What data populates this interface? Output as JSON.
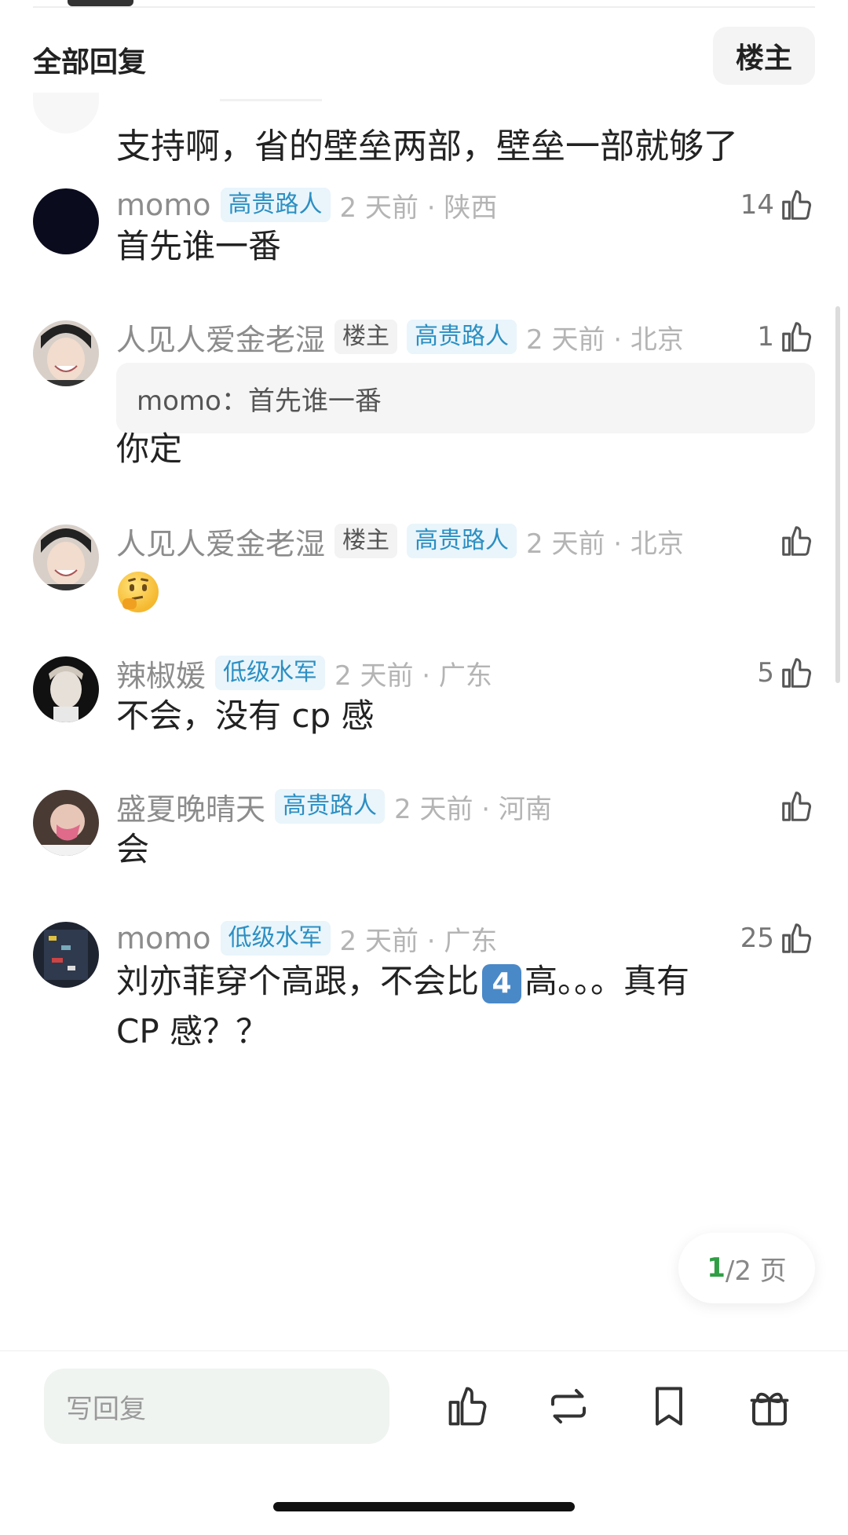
{
  "header": {
    "title": "全部回复",
    "owner_filter": "楼主"
  },
  "partial_comment": {
    "text": "支持啊，省的壁垒两部，壁垒一部就够了"
  },
  "comments": [
    {
      "username": "momo",
      "badges": [
        "高贵路人"
      ],
      "time": "2 天前 · 陕西",
      "likes": "14",
      "text": "首先谁一番"
    },
    {
      "username": "人见人爱金老湿",
      "badges": [
        "楼主",
        "高贵路人"
      ],
      "time": "2 天前 · 北京",
      "likes": "1",
      "quote": "momo：首先谁一番",
      "text": "你定"
    },
    {
      "username": "人见人爱金老湿",
      "badges": [
        "楼主",
        "高贵路人"
      ],
      "time": "2 天前 · 北京",
      "likes": "",
      "emoji": "thinking-face"
    },
    {
      "username": "辣椒媛",
      "badges": [
        "低级水军"
      ],
      "time": "2 天前 · 广东",
      "likes": "5",
      "text": "不会，没有 cp 感"
    },
    {
      "username": "盛夏晚晴天",
      "badges": [
        "高贵路人"
      ],
      "time": "2 天前 · 河南",
      "likes": "",
      "text": "会"
    },
    {
      "username": "momo",
      "badges": [
        "低级水军"
      ],
      "time": "2 天前 · 广东",
      "likes": "25",
      "text_a": "刘亦菲穿个高跟，不会比",
      "keycap": "4",
      "text_b": "高。。。真有",
      "text_line2": "CP 感？？"
    }
  ],
  "pagination": {
    "current": "1",
    "total_label": "/2 页"
  },
  "bottom_bar": {
    "reply_placeholder": "写回复"
  },
  "colors": {
    "badge_blue": "#2c8fc2",
    "muted": "#b4b4b4",
    "page_current": "#2f9e44"
  }
}
